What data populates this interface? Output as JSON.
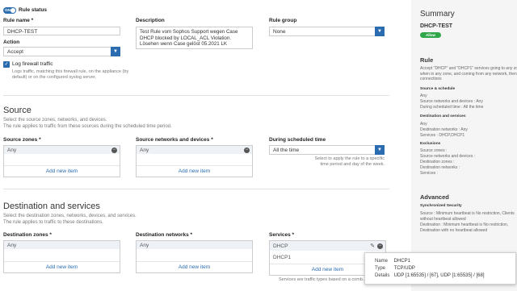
{
  "rule_status": {
    "toggle": "ON",
    "label": "Rule status"
  },
  "rule_name": {
    "label": "Rule name *",
    "value": "DHCP-TEST"
  },
  "description": {
    "label": "Description",
    "value": "Test Rule vom Sophos Support wegen Case DHCP blocked by LOCAL_ACL Violation. Lösehen wenn Case gelöst 05.2021 LK"
  },
  "rule_group": {
    "label": "Rule group",
    "value": "None"
  },
  "action": {
    "label": "Action",
    "value": "Accept"
  },
  "log_traffic": {
    "label": "Log firewall traffic",
    "hint": "Logs traffic, matching this firewall rule, on the appliance (by default) or on the configured syslog server."
  },
  "source": {
    "title": "Source",
    "desc1": "Select the source zones, networks, and devices.",
    "desc2": "The rule applies to traffic from these sources during the scheduled time period.",
    "zones_label": "Source zones *",
    "zones_item": "Any",
    "zones_add": "Add new item",
    "networks_label": "Source networks and devices *",
    "networks_item": "Any",
    "networks_add": "Add new item",
    "schedule_label": "During scheduled time",
    "schedule_value": "All the time",
    "schedule_hint": "Select to apply the rule to a specific time period and day of the week."
  },
  "destination": {
    "title": "Destination and services",
    "desc1": "Select the destination zones, networks, devices, and services.",
    "desc2": "The rule applies to traffic to these destinations.",
    "zones_label": "Destination zones *",
    "zones_item": "Any",
    "zones_add": "Add new item",
    "networks_label": "Destination networks *",
    "networks_item": "Any",
    "networks_add": "Add new item",
    "services_label": "Services *",
    "services_items": [
      "DHCP",
      "DHCP1"
    ],
    "services_add": "Add new item",
    "services_hint": "Services are traffic types based on a comb... ports"
  },
  "tooltip": {
    "name_key": "Name",
    "name_val": "DHCP1",
    "type_key": "Type",
    "type_val": "TCP/UDP",
    "details_key": "Details",
    "details_val": "UDP [1:65535] / [67], UDP [1:65535] / [68]"
  },
  "summary": {
    "title": "Summary",
    "rule_name": "DHCP-TEST",
    "badge": "Allow",
    "rule_heading": "Rule",
    "rule_text": "Accept \"DHCP\" and \"DHCP1\" services going to any zone when in any zone, and coming from any network, then log connections",
    "src_heading": "Source & schedule",
    "src_lines": [
      "Any",
      "Source networks and devices : Any",
      "During scheduled time : All the time"
    ],
    "dst_heading": "Destination and services",
    "dst_lines": [
      "Any",
      "Destination networks : Any",
      "Services : DHCP,DHCP1"
    ],
    "exc_heading": "Exclusions",
    "exc_lines": [
      "Source zones :",
      "Source networks and devices :",
      "Destination zones :",
      "Destination networks :",
      "Services :"
    ],
    "adv_heading": "Advanced",
    "sync_heading": "Synchronized Security",
    "sync_lines": [
      "Source : Minimum heartbeat is No restriction, Clients without heartbeat allowed",
      "Destination : Minimum heartbeat is No restriction, Destination with no heartbeat allowed"
    ]
  },
  "colors": {
    "accent": "#2b6cb0",
    "badge": "#2fa64a"
  }
}
